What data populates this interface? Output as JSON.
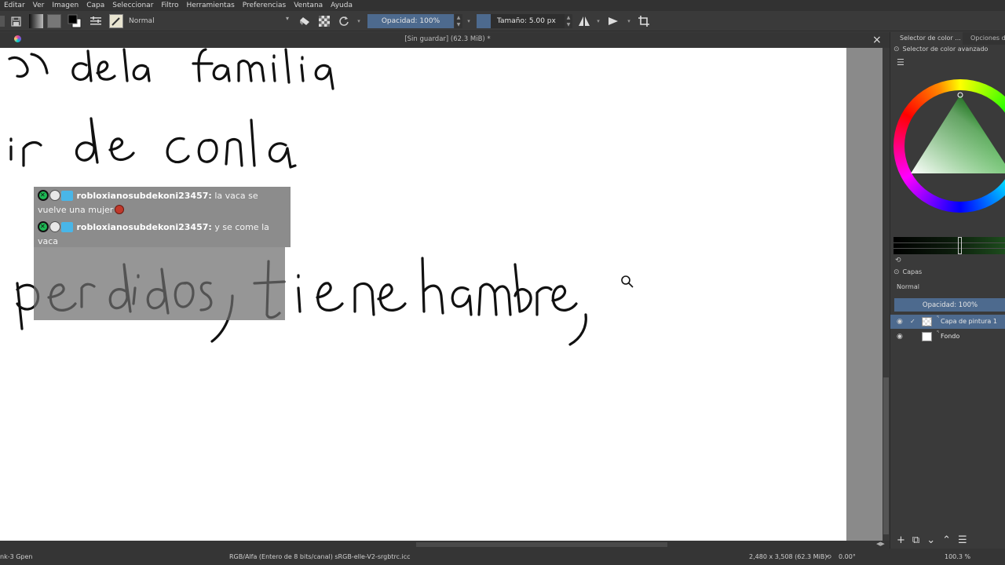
{
  "menu": [
    "Editar",
    "Ver",
    "Imagen",
    "Capa",
    "Seleccionar",
    "Filtro",
    "Herramientas",
    "Preferencias",
    "Ventana",
    "Ayuda"
  ],
  "toolbar": {
    "blend_mode": "Normal",
    "opacity_label": "Opacidad: 100%",
    "size_label": "Tamaño: 5.00 px",
    "fg_color": "#000000",
    "bg_color": "#ffffff"
  },
  "document": {
    "title": "[Sin guardar]  (62.3 MiB) *",
    "close_glyph": "×"
  },
  "canvas": {
    "handwriting": [
      "a de la familia",
      "ir de conla",
      "perdidos, tiene hambre,"
    ]
  },
  "chat": {
    "messages": [
      {
        "user": "robloxianosubdekoni23457",
        "text_a": "la vaca se",
        "text_b": "vuelve una mujer"
      },
      {
        "user": "robloxianosubdekoni23457",
        "text_a": "y se come la",
        "text_b": "vaca"
      }
    ]
  },
  "dock": {
    "tab_color_selector": "Selector de color ...",
    "tab_tool_options": "Opciones de",
    "advanced_color_selector": "Selector de color avanzado",
    "layers_title": "Capas",
    "layers_blend": "Normal",
    "layers_opacity": "Opacidad:  100%",
    "layers": [
      {
        "name": "Capa de pintura 1",
        "selected": true
      },
      {
        "name": "Fondo",
        "selected": false
      }
    ]
  },
  "status": {
    "brush": "nk-3 Gpen",
    "color_space": "RGB/Alfa (Entero de 8 bits/canal)  sRGB-elle-V2-srgbtrc.icc",
    "image_size": "2,480 x 3,508 (62.3 MiB)",
    "rotation": "0.00°",
    "zoom": "100.3 %"
  },
  "colors": {
    "accent": "#4d6a8e",
    "app_bg": "#3a3a3a",
    "canvas_bg": "#ffffff"
  }
}
